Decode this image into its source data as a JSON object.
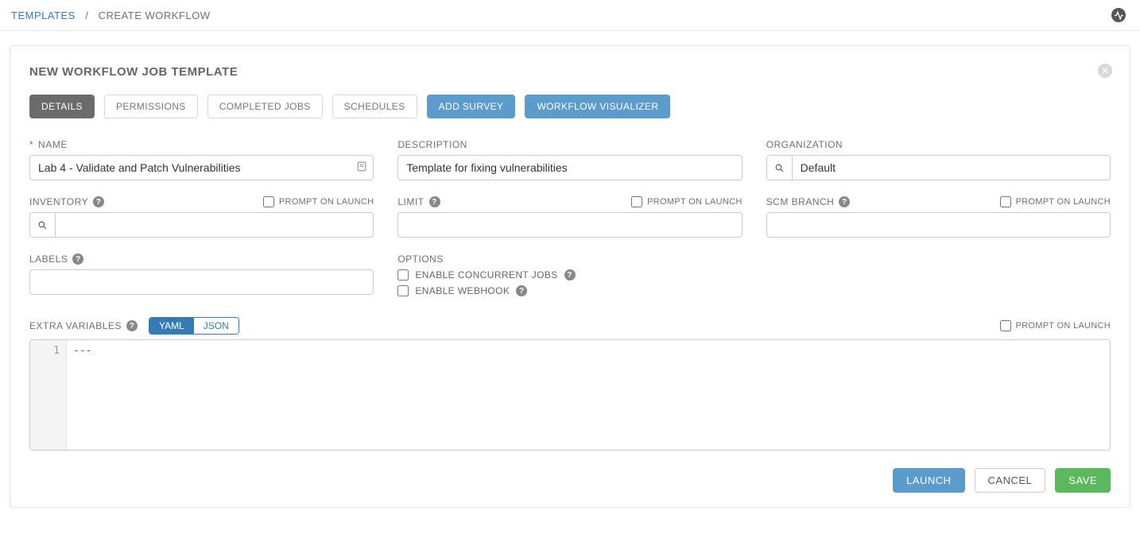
{
  "breadcrumb": {
    "root": "TEMPLATES",
    "separator": "/",
    "current": "CREATE WORKFLOW"
  },
  "card": {
    "title": "NEW WORKFLOW JOB TEMPLATE"
  },
  "tabs": {
    "details": "DETAILS",
    "permissions": "PERMISSIONS",
    "completed_jobs": "COMPLETED JOBS",
    "schedules": "SCHEDULES",
    "add_survey": "ADD SURVEY",
    "workflow_visualizer": "WORKFLOW VISUALIZER"
  },
  "fields": {
    "name": {
      "label": "NAME",
      "value": "Lab 4 - Validate and Patch Vulnerabilities"
    },
    "description": {
      "label": "DESCRIPTION",
      "value": "Template for fixing vulnerabilities"
    },
    "organization": {
      "label": "ORGANIZATION",
      "value": "Default"
    },
    "inventory": {
      "label": "INVENTORY",
      "prompt": "PROMPT ON LAUNCH",
      "value": ""
    },
    "limit": {
      "label": "LIMIT",
      "prompt": "PROMPT ON LAUNCH",
      "value": ""
    },
    "scm_branch": {
      "label": "SCM BRANCH",
      "prompt": "PROMPT ON LAUNCH",
      "value": ""
    },
    "labels": {
      "label": "LABELS",
      "value": ""
    },
    "options": {
      "label": "OPTIONS",
      "concurrent": "ENABLE CONCURRENT JOBS",
      "webhook": "ENABLE WEBHOOK"
    },
    "extra_vars": {
      "label": "EXTRA VARIABLES",
      "yaml": "YAML",
      "json": "JSON",
      "prompt": "PROMPT ON LAUNCH",
      "line_number": "1",
      "content": "---"
    }
  },
  "actions": {
    "launch": "LAUNCH",
    "cancel": "CANCEL",
    "save": "SAVE"
  }
}
